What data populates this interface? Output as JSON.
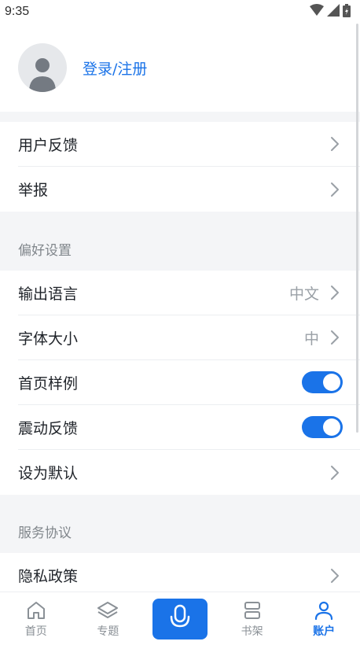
{
  "status": {
    "time": "9:35"
  },
  "profile": {
    "login_label": "登录/注册"
  },
  "group1": {
    "items": [
      {
        "label": "用户反馈"
      },
      {
        "label": "举报"
      }
    ]
  },
  "preferences": {
    "title": "偏好设置",
    "items": [
      {
        "label": "输出语言",
        "value": "中文"
      },
      {
        "label": "字体大小",
        "value": "中"
      },
      {
        "label": "首页样例",
        "toggle": true
      },
      {
        "label": "震动反馈",
        "toggle": true
      },
      {
        "label": "设为默认"
      }
    ]
  },
  "agreements": {
    "title": "服务协议",
    "items": [
      {
        "label": "隐私政策"
      }
    ]
  },
  "tabs": [
    {
      "label": "首页",
      "icon": "home-icon"
    },
    {
      "label": "专题",
      "icon": "layers-icon"
    },
    {
      "label": "",
      "icon": "mic-icon"
    },
    {
      "label": "书架",
      "icon": "bookshelf-icon"
    },
    {
      "label": "账户",
      "icon": "person-icon",
      "active": true
    }
  ],
  "colors": {
    "accent": "#1a73e8",
    "background": "#f4f5f7"
  }
}
